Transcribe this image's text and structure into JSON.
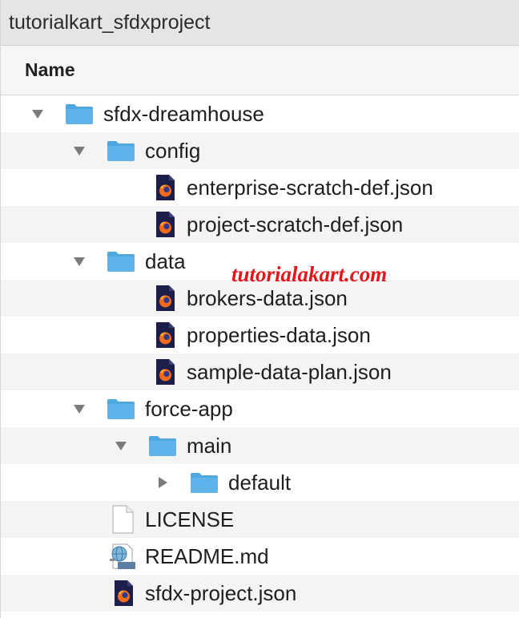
{
  "window": {
    "title": "tutorialkart_sfdxproject"
  },
  "header": {
    "name_label": "Name"
  },
  "watermark": {
    "text": "tutorialakart.com"
  },
  "colors": {
    "folder": "#5db3ea",
    "folder_tab": "#4fa7e0",
    "firefox_orange": "#f26b1d",
    "firefox_dark": "#1d1f4a",
    "watermark": "#e4161c"
  },
  "tree": [
    {
      "label": "sfdx-dreamhouse",
      "depth": 0,
      "type": "folder",
      "disclosure": "expanded"
    },
    {
      "label": "config",
      "depth": 1,
      "type": "folder",
      "disclosure": "expanded"
    },
    {
      "label": "enterprise-scratch-def.json",
      "depth": 2,
      "type": "json-file",
      "disclosure": "none"
    },
    {
      "label": "project-scratch-def.json",
      "depth": 2,
      "type": "json-file",
      "disclosure": "none"
    },
    {
      "label": "data",
      "depth": 1,
      "type": "folder",
      "disclosure": "expanded"
    },
    {
      "label": "brokers-data.json",
      "depth": 2,
      "type": "json-file",
      "disclosure": "none"
    },
    {
      "label": "properties-data.json",
      "depth": 2,
      "type": "json-file",
      "disclosure": "none"
    },
    {
      "label": "sample-data-plan.json",
      "depth": 2,
      "type": "json-file",
      "disclosure": "none"
    },
    {
      "label": "force-app",
      "depth": 1,
      "type": "folder",
      "disclosure": "expanded"
    },
    {
      "label": "main",
      "depth": 2,
      "type": "folder",
      "disclosure": "expanded"
    },
    {
      "label": "default",
      "depth": 3,
      "type": "folder",
      "disclosure": "collapsed"
    },
    {
      "label": "LICENSE",
      "depth": 1,
      "type": "plain-file",
      "disclosure": "none"
    },
    {
      "label": "README.md",
      "depth": 1,
      "type": "text-file",
      "disclosure": "none"
    },
    {
      "label": "sfdx-project.json",
      "depth": 1,
      "type": "json-file",
      "disclosure": "none"
    }
  ]
}
